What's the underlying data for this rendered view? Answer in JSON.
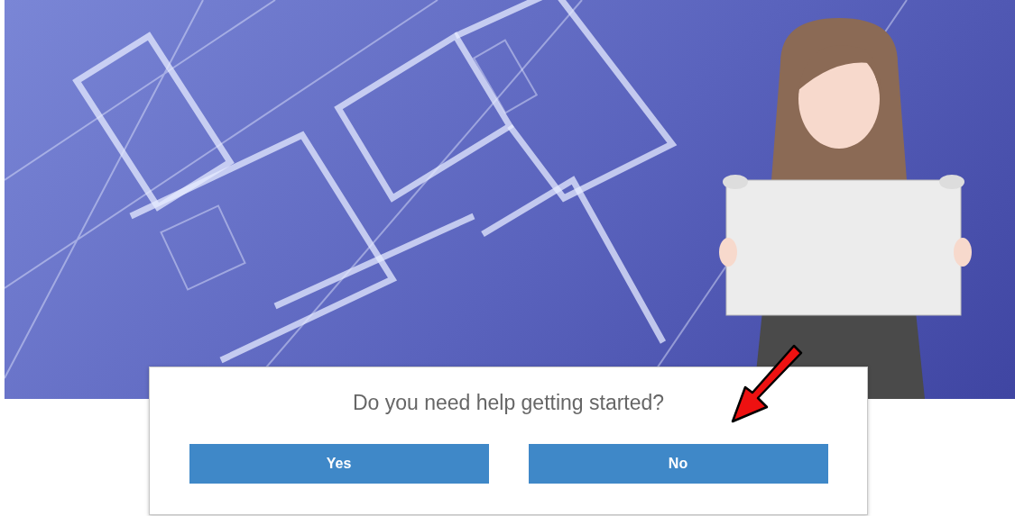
{
  "dialog": {
    "question": "Do you need help getting started?",
    "buttons": [
      {
        "label": "Yes"
      },
      {
        "label": "No"
      }
    ]
  }
}
